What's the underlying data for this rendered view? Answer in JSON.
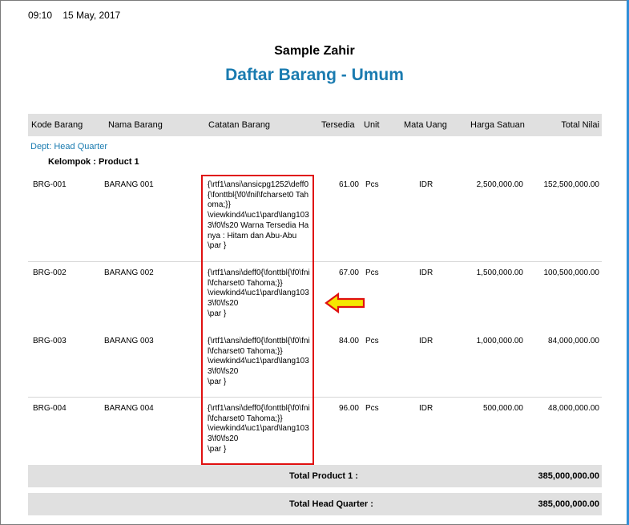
{
  "header": {
    "time": "09:10",
    "date": "15 May, 2017"
  },
  "report": {
    "company": "Sample Zahir",
    "title": "Daftar Barang - Umum"
  },
  "columns": {
    "kode": "Kode Barang",
    "nama": "Nama Barang",
    "catatan": "Catatan Barang",
    "tersedia": "Tersedia",
    "unit": "Unit",
    "mata_uang": "Mata Uang",
    "harga": "Harga Satuan",
    "total": "Total Nilai"
  },
  "dept_label": "Dept: Head Quarter",
  "group_label": "Kelompok : Product 1",
  "rows": [
    {
      "kode": "BRG-001",
      "nama": "BARANG 001",
      "catatan": "{\\rtf1\\ansi\\ansicpg1252\\deff0{\\fonttbl{\\f0\\fnil\\fcharset0 Tahoma;}}\n\\viewkind4\\uc1\\pard\\lang1033\\f0\\fs20 Warna Tersedia Hanya : Hitam dan Abu-Abu\n\\par }",
      "tersedia": "61.00",
      "unit": "Pcs",
      "mata_uang": "IDR",
      "harga": "2,500,000.00",
      "total": "152,500,000.00"
    },
    {
      "kode": "BRG-002",
      "nama": "BARANG 002",
      "catatan": "{\\rtf1\\ansi\\deff0{\\fonttbl{\\f0\\fnil\\fcharset0 Tahoma;}}\n\\viewkind4\\uc1\\pard\\lang1033\\f0\\fs20\n\\par }",
      "tersedia": "67.00",
      "unit": "Pcs",
      "mata_uang": "IDR",
      "harga": "1,500,000.00",
      "total": "100,500,000.00"
    },
    {
      "kode": "BRG-003",
      "nama": "BARANG 003",
      "catatan": "{\\rtf1\\ansi\\deff0{\\fonttbl{\\f0\\fnil\\fcharset0 Tahoma;}}\n\\viewkind4\\uc1\\pard\\lang1033\\f0\\fs20\n\\par }",
      "tersedia": "84.00",
      "unit": "Pcs",
      "mata_uang": "IDR",
      "harga": "1,000,000.00",
      "total": "84,000,000.00"
    },
    {
      "kode": "BRG-004",
      "nama": "BARANG 004",
      "catatan": "{\\rtf1\\ansi\\deff0{\\fonttbl{\\f0\\fnil\\fcharset0 Tahoma;}}\n\\viewkind4\\uc1\\pard\\lang1033\\f0\\fs20\n\\par }",
      "tersedia": "96.00",
      "unit": "Pcs",
      "mata_uang": "IDR",
      "harga": "500,000.00",
      "total": "48,000,000.00"
    }
  ],
  "totals": {
    "group_label": "Total Product 1 :",
    "group_value": "385,000,000.00",
    "dept_label": "Total Head Quarter :",
    "dept_value": "385,000,000.00"
  },
  "annotation": {
    "highlight_color": "#e01010",
    "arrow_color": "#f5e600",
    "arrow_icon": "left-arrow-icon"
  }
}
